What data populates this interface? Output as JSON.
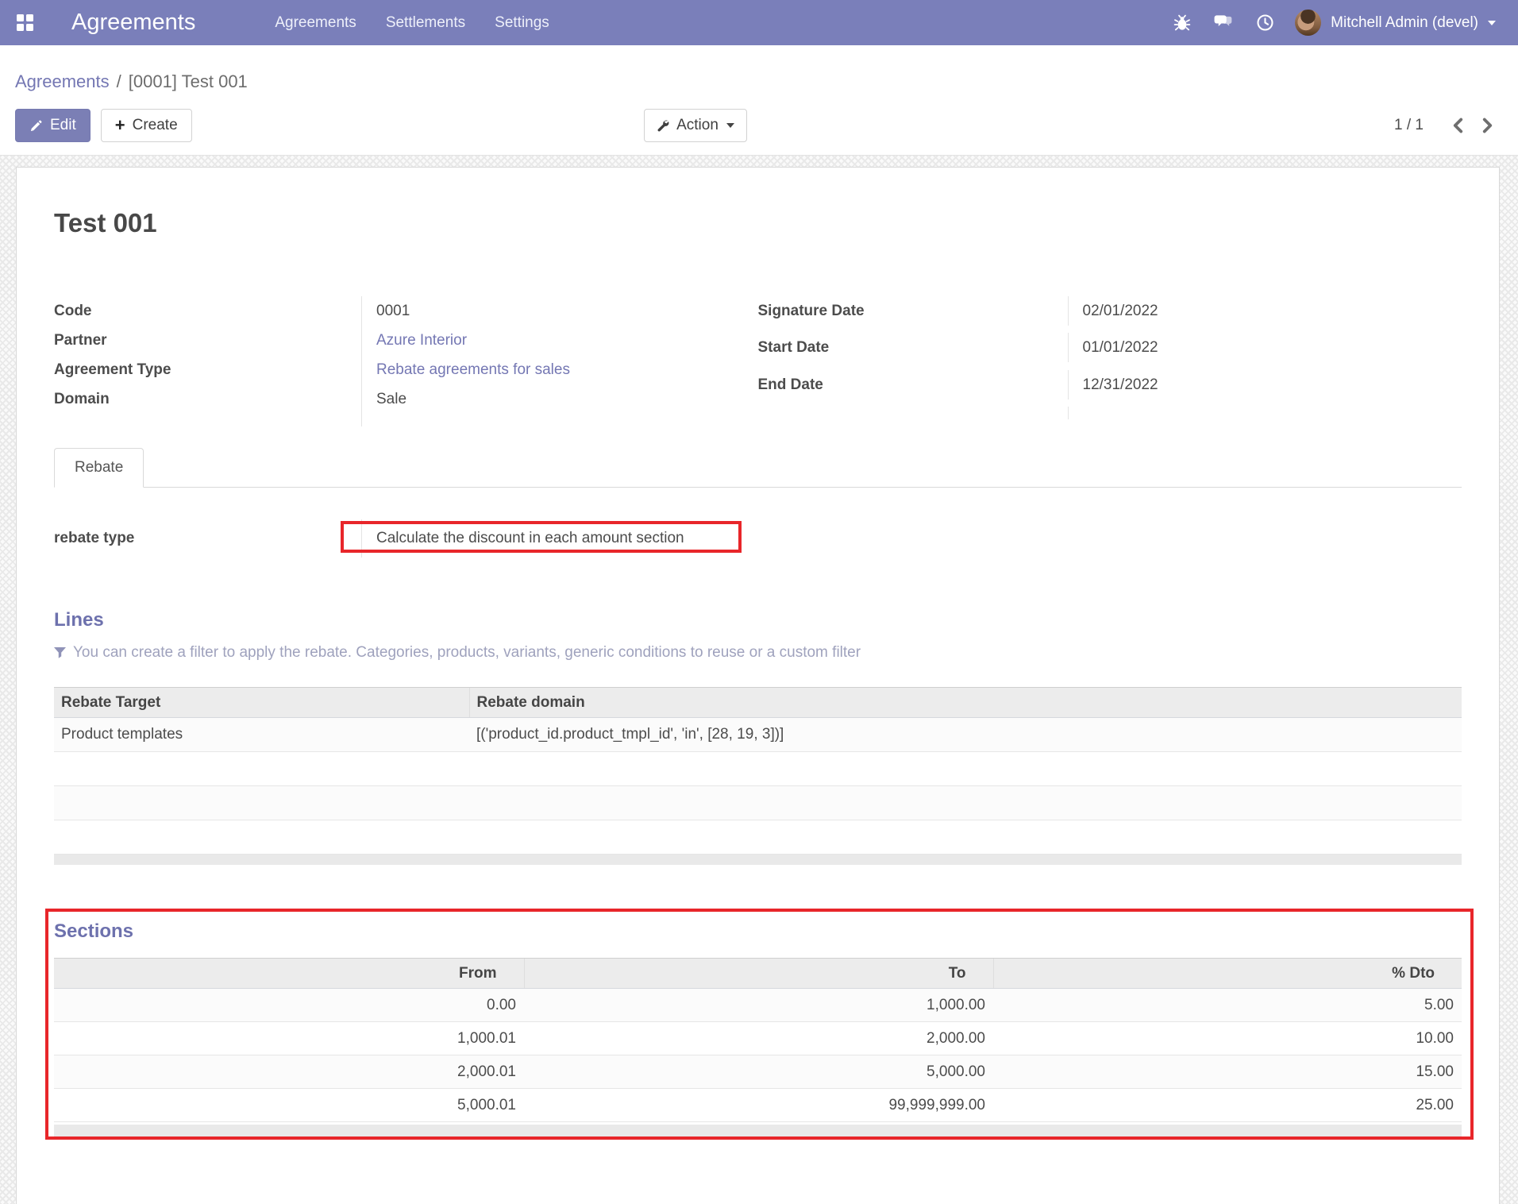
{
  "navbar": {
    "brand": "Agreements",
    "menus": [
      "Agreements",
      "Settlements",
      "Settings"
    ],
    "user": "Mitchell Admin (devel)"
  },
  "breadcrumb": {
    "parent": "Agreements",
    "separator": "/",
    "current": "[0001] Test 001"
  },
  "toolbar": {
    "edit": "Edit",
    "create": "Create",
    "action": "Action",
    "pager": "1 / 1"
  },
  "record": {
    "title": "Test 001",
    "fields_left": [
      {
        "label": "Code",
        "value": "0001"
      },
      {
        "label": "Partner",
        "value": "Azure Interior"
      },
      {
        "label": "Agreement Type",
        "value": "Rebate agreements for sales"
      },
      {
        "label": "Domain",
        "value": "Sale"
      }
    ],
    "fields_right": [
      {
        "label": "Signature Date",
        "value": "02/01/2022"
      },
      {
        "label": "Start Date",
        "value": "01/01/2022"
      },
      {
        "label": "End Date",
        "value": "12/31/2022"
      }
    ],
    "tab": "Rebate",
    "rebate_type": {
      "label": "rebate type",
      "value": "Calculate the discount in each amount section"
    }
  },
  "lines": {
    "heading": "Lines",
    "hint": "You can create a filter to apply the rebate. Categories, products, variants, generic conditions to reuse or a custom filter",
    "columns": [
      "Rebate Target",
      "Rebate domain"
    ],
    "rows": [
      [
        "Product templates",
        "[('product_id.product_tmpl_id', 'in', [28, 19, 3])]"
      ]
    ]
  },
  "sections": {
    "heading": "Sections",
    "columns": [
      "From",
      "To",
      "% Dto"
    ],
    "rows": [
      [
        "0.00",
        "1,000.00",
        "5.00"
      ],
      [
        "1,000.01",
        "2,000.00",
        "10.00"
      ],
      [
        "2,000.01",
        "5,000.00",
        "15.00"
      ],
      [
        "5,000.01",
        "99,999,999.00",
        "25.00"
      ]
    ]
  },
  "colors": {
    "navbar_bg": "#7a7fba",
    "primary_button": "#7b7fb5",
    "link": "#7477b3",
    "heading": "#6d71ad",
    "highlight_red": "#e8262a"
  },
  "icons": {
    "apps": "grid-squares",
    "debug": "bug",
    "messages": "chat-bubbles",
    "activities": "clock",
    "user_menu": "caret-down",
    "edit": "pencil",
    "create": "plus",
    "action": "wrench",
    "filter": "funnel",
    "pager_prev": "chevron-left",
    "pager_next": "chevron-right"
  }
}
